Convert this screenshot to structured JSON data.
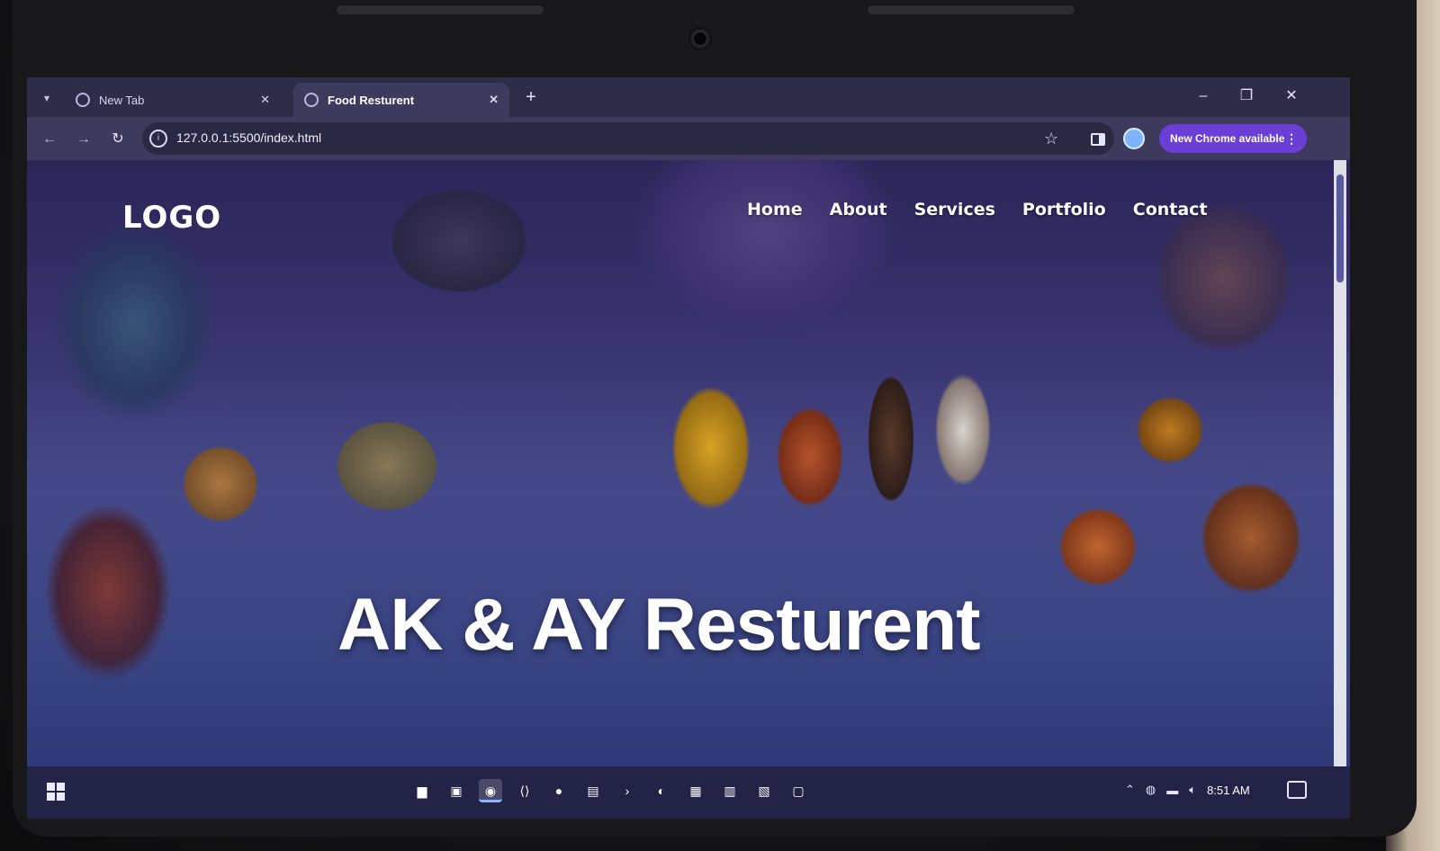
{
  "browser": {
    "tabs": [
      {
        "label": "New Tab",
        "active": false
      },
      {
        "label": "Food Resturent",
        "active": true
      }
    ],
    "url": "127.0.0.1:5500/index.html",
    "update_label": "New Chrome available",
    "icons": [
      "chevron-down-icon",
      "close-icon",
      "plus-icon",
      "minimize-icon",
      "restore-icon",
      "back-icon",
      "forward-icon",
      "reload-icon",
      "site-info-icon",
      "star-icon",
      "side-panel-icon",
      "profile-icon",
      "more-icon"
    ]
  },
  "page": {
    "logo": "LOGO",
    "nav": [
      "Home",
      "About",
      "Services",
      "Portfolio",
      "Contact"
    ],
    "hero_title": "AK & AY Resturent"
  },
  "taskbar": {
    "clock": "8:51 AM",
    "apps": [
      "file-explorer-icon",
      "store-icon",
      "chrome-icon",
      "vscode-icon",
      "github-icon",
      "terminal-icon",
      "arrow-icon",
      "telegram-icon",
      "notes-icon",
      "docs-icon",
      "app-icon",
      "folder-icon"
    ]
  },
  "colors": {
    "tab_bar": "#2e2c48",
    "toolbar": "#3d3a5e",
    "update_button": "#6b3fd6",
    "taskbar": "#232247"
  }
}
